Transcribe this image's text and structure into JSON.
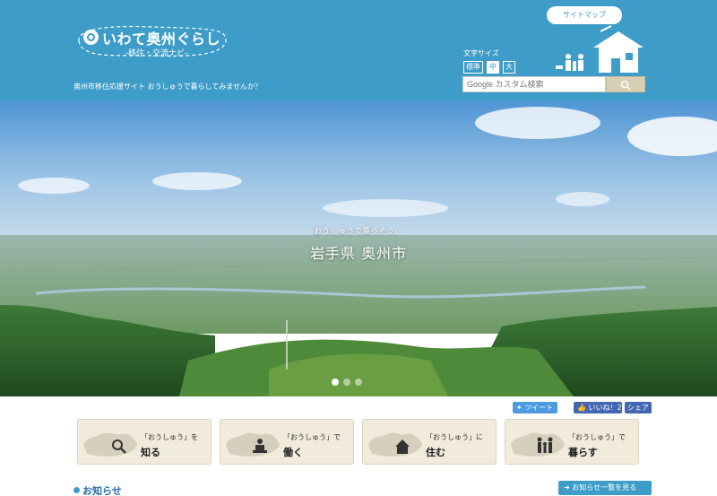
{
  "header": {
    "logo_title": "いわて奥州ぐらし",
    "logo_subtitle": "-移住・交流ナビ-",
    "tagline": "奥州市移住応援サイト おうしゅうで暮らしてみませんか？",
    "font_size_label": "文字サイズ",
    "font_size_options": [
      "標準",
      "中",
      "大"
    ],
    "search_placeholder": "Google カスタム検索",
    "sitemap_label": "サイトマップ",
    "search_icon": "search-icon",
    "background": "#3e9dc8"
  },
  "hero": {
    "catch_small": "おうしゅうで暮らそう。",
    "catch_big": "岩手県 奥州市",
    "slides": 3,
    "active_slide": 1
  },
  "social": {
    "tweet": "ツイート",
    "like": "いいね！2",
    "share": "シェア"
  },
  "cards": [
    {
      "quote": "「おうしゅう」を",
      "verb": "知る",
      "icon": "magnifier-icon"
    },
    {
      "quote": "「おうしゅう」で",
      "verb": "働く",
      "icon": "worker-icon"
    },
    {
      "quote": "「おうしゅう」に",
      "verb": "住む",
      "icon": "house-icon"
    },
    {
      "quote": "「おうしゅう」で",
      "verb": "暮らす",
      "icon": "family-icon"
    }
  ],
  "news": {
    "title": "お知らせ",
    "list_button": "お知らせ一覧を見る"
  }
}
